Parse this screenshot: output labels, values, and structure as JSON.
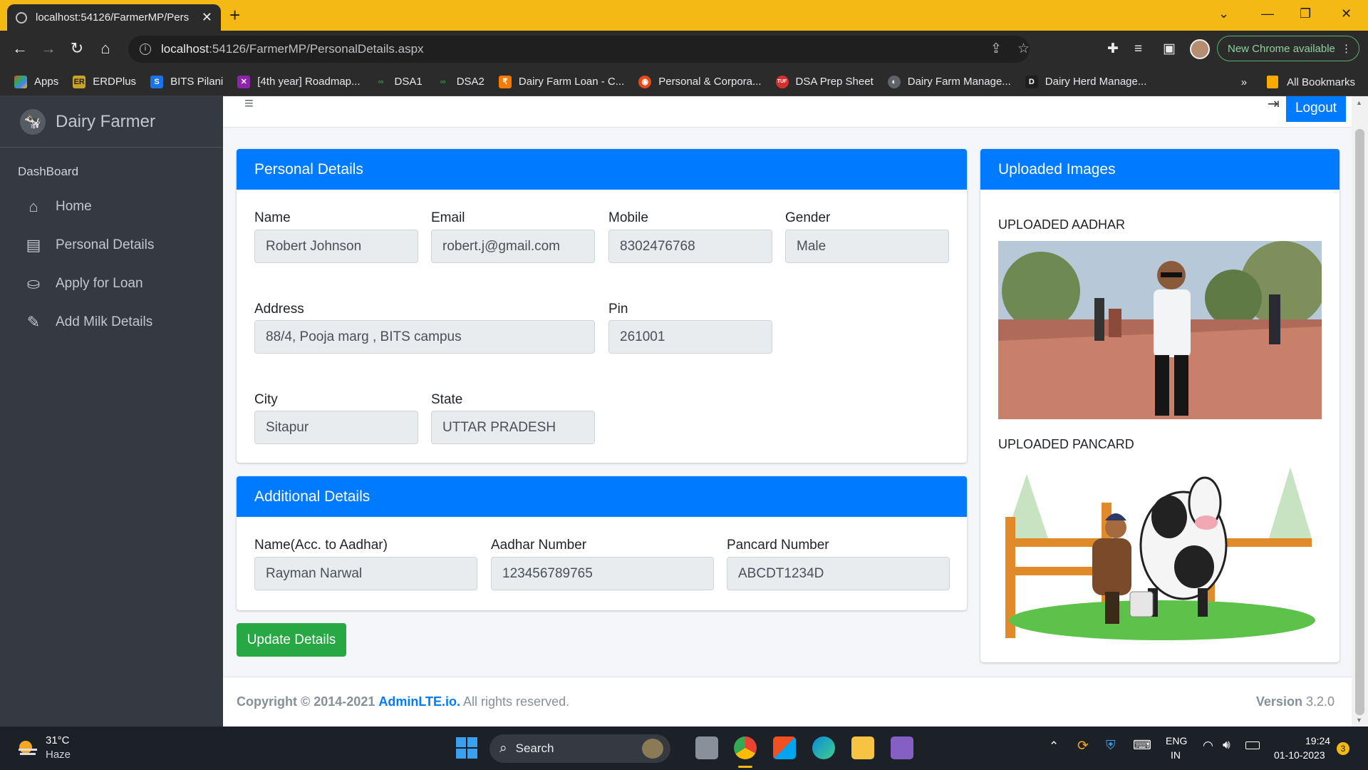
{
  "browser": {
    "tab_title": "localhost:54126/FarmerMP/Pers",
    "url_host": "localhost",
    "url_rest": ":54126/FarmerMP/PersonalDetails.aspx",
    "new_chrome": "New Chrome available",
    "bookmarks": [
      {
        "label": "Apps",
        "icon": "apps-grid-icon"
      },
      {
        "label": "ERDPlus",
        "icon": "erdplus-icon"
      },
      {
        "label": "BITS Pilani",
        "icon": "bits-icon"
      },
      {
        "label": "[4th year] Roadmap...",
        "icon": "roadmap-icon"
      },
      {
        "label": "DSA1",
        "icon": "dsa-icon"
      },
      {
        "label": "DSA2",
        "icon": "dsa-icon"
      },
      {
        "label": "Dairy Farm Loan - C...",
        "icon": "loan-icon"
      },
      {
        "label": "Personal & Corpora...",
        "icon": "bank-icon"
      },
      {
        "label": "DSA Prep Sheet",
        "icon": "tuf-icon"
      },
      {
        "label": "Dairy Farm Manage...",
        "icon": "globe-icon"
      },
      {
        "label": "Dairy Herd Manage...",
        "icon": "d-icon"
      }
    ],
    "bookmarks_more": "»",
    "all_bookmarks": "All Bookmarks"
  },
  "sidebar": {
    "brand": "Dairy Farmer",
    "header": "DashBoard",
    "items": [
      {
        "label": "Home",
        "icon": "home-icon"
      },
      {
        "label": "Personal Details",
        "icon": "id-card-icon"
      },
      {
        "label": "Apply for Loan",
        "icon": "hand-money-icon"
      },
      {
        "label": "Add Milk Details",
        "icon": "edit-icon"
      }
    ]
  },
  "topnav": {
    "logout": "Logout"
  },
  "personal": {
    "title": "Personal Details",
    "name_label": "Name",
    "name": "Robert Johnson",
    "email_label": "Email",
    "email": "robert.j@gmail.com",
    "mobile_label": "Mobile",
    "mobile": "8302476768",
    "gender_label": "Gender",
    "gender": "Male",
    "address_label": "Address",
    "address": "88/4, Pooja marg , BITS campus",
    "pin_label": "Pin",
    "pin": "261001",
    "city_label": "City",
    "city": "Sitapur",
    "state_label": "State",
    "state": "UTTAR PRADESH"
  },
  "additional": {
    "title": "Additional Details",
    "aadhar_name_label": "Name(Acc. to Aadhar)",
    "aadhar_name": "Rayman Narwal",
    "aadhar_no_label": "Aadhar Number",
    "aadhar_no": "123456789765",
    "pan_label": "Pancard Number",
    "pan": "ABCDT1234D"
  },
  "update_button": "Update Details",
  "images": {
    "title": "Uploaded Images",
    "aadhar_label": "UPLOADED AADHAR",
    "pan_label": "UPLOADED PANCARD"
  },
  "footer": {
    "copyright": "Copyright © 2014-2021",
    "brand": "AdminLTE.io.",
    "rights": "All rights reserved.",
    "version_label": "Version",
    "version": "3.2.0"
  },
  "taskbar": {
    "temp": "31°C",
    "weather": "Haze",
    "search": "Search",
    "lang1": "ENG",
    "lang2": "IN",
    "time": "19:24",
    "date": "01-10-2023",
    "badge": "3"
  },
  "colors": {
    "primary": "#007bff",
    "success": "#28a745",
    "sidebar": "#343a40",
    "tabstrip": "#f5b915"
  }
}
